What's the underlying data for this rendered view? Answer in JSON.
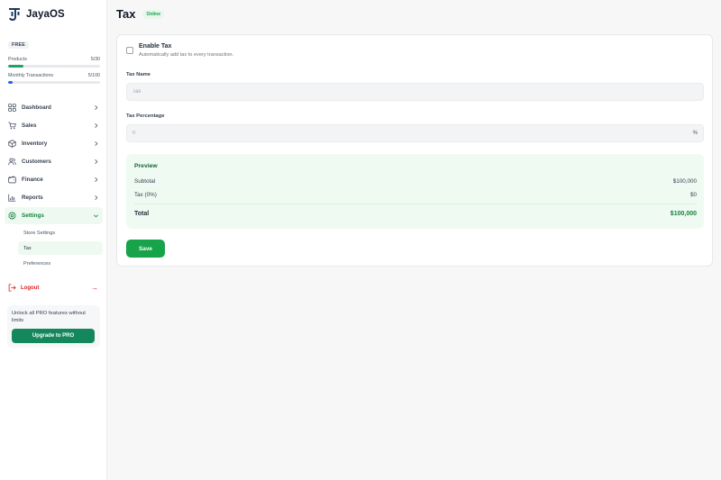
{
  "app": {
    "name": "JayaOS",
    "logo_icon": "jayaos-logo-icon",
    "accent": "#16a34a"
  },
  "plan": {
    "badge": "FREE",
    "usage": [
      {
        "label": "Products",
        "count": "5/30",
        "fraction": 0.167,
        "color": "#22a365"
      },
      {
        "label": "Monthly Transactions",
        "count": "5/100",
        "fraction": 0.05,
        "color": "#2563eb"
      }
    ]
  },
  "sidebar": {
    "items": [
      {
        "label": "Dashboard",
        "icon": "dashboard-grid-icon"
      },
      {
        "label": "Sales",
        "icon": "shopping-cart-icon"
      },
      {
        "label": "Inventory",
        "icon": "box-icon"
      },
      {
        "label": "Customers",
        "icon": "users-icon"
      },
      {
        "label": "Finance",
        "icon": "wallet-icon"
      },
      {
        "label": "Reports",
        "icon": "bar-chart-icon"
      },
      {
        "label": "Settings",
        "icon": "gear-icon",
        "expanded": true
      }
    ],
    "settings_subitems": [
      "Store Settings",
      "Tax",
      "Preferences"
    ],
    "active_subitem": "Tax",
    "logout_label": "Logout"
  },
  "promo": {
    "text": "Unlock all PRO features without limits",
    "button_label": "Upgrade to PRO"
  },
  "page": {
    "title": "Tax",
    "status": "Online"
  },
  "form": {
    "enable_label": "Enable Tax",
    "enable_description": "Automatically add tax to every transaction.",
    "enable_checked": false,
    "tax_name_label": "Tax Name",
    "tax_name_placeholder": "Tax",
    "tax_percentage_label": "Tax Percentage",
    "tax_percentage_placeholder": "0",
    "tax_percentage_suffix": "%",
    "save_label": "Save"
  },
  "preview": {
    "title": "Preview",
    "subtotal_label": "Subtotal",
    "subtotal_value": "$100,000",
    "tax_label": "Tax (0%)",
    "tax_value": "$0",
    "total_label": "Total",
    "total_value": "$100,000"
  }
}
